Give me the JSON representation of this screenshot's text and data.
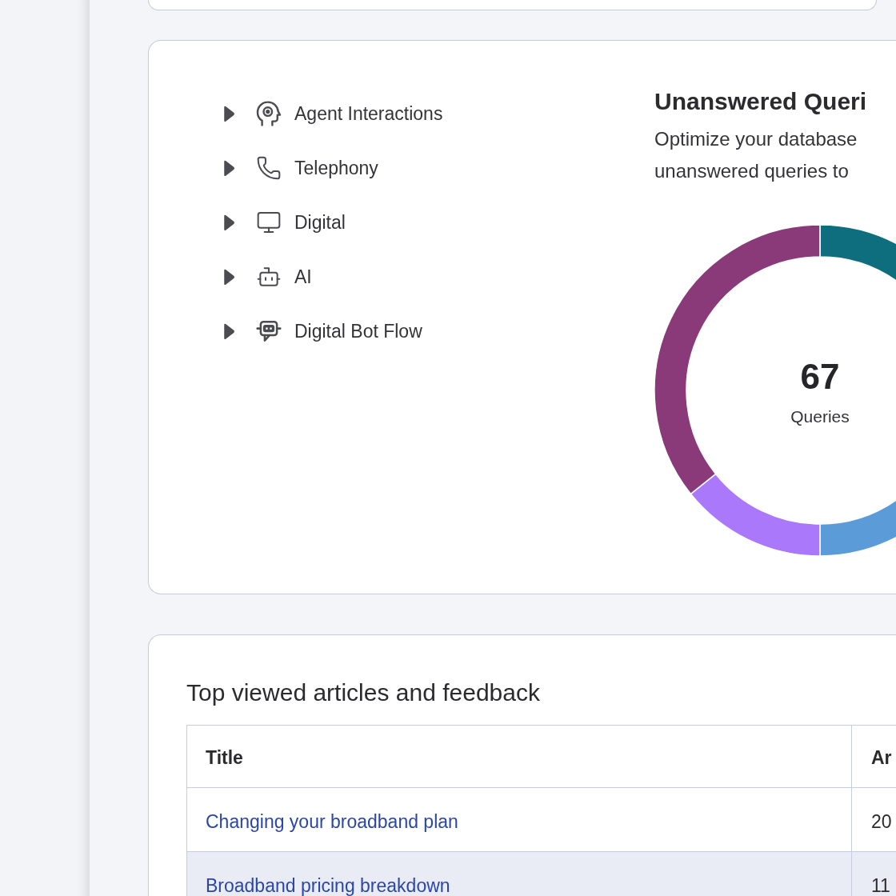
{
  "tree": {
    "items": [
      {
        "label": "Agent Interactions",
        "expanded": false
      },
      {
        "label": "Telephony",
        "expanded": false
      },
      {
        "label": "Digital",
        "expanded": false
      },
      {
        "label": "AI",
        "expanded": false
      },
      {
        "label": "Digital Bot Flow",
        "expanded": false
      }
    ]
  },
  "unanswered_queries": {
    "title": "Unanswered Queri",
    "description": "Optimize your database unanswered queries to",
    "total": "67",
    "total_label": "Queries"
  },
  "top_articles": {
    "title": "Top viewed articles and feedback",
    "table": {
      "columns": [
        "Title",
        "Ar"
      ],
      "rows": [
        {
          "title": "Changing your broadband plan",
          "column_2": "20"
        },
        {
          "title": "Broadband pricing breakdown",
          "column_2": "11"
        }
      ]
    }
  }
}
